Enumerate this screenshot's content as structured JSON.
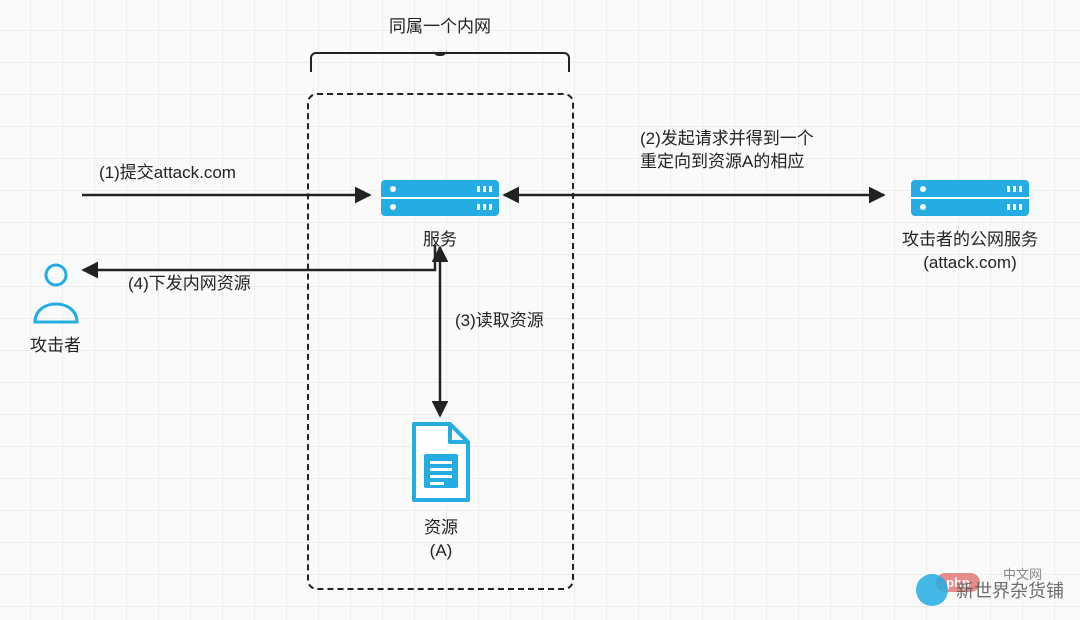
{
  "title": "同属一个内网",
  "nodes": {
    "attacker": {
      "label": "攻击者"
    },
    "service": {
      "label": "服务"
    },
    "resource": {
      "label_line1": "资源",
      "label_line2": "(A)"
    },
    "external_server": {
      "label_line1": "攻击者的公网服务",
      "label_line2": "(attack.com)"
    }
  },
  "edges": {
    "step1": "(1)提交attack.com",
    "step2_line1": "(2)发起请求并得到一个",
    "step2_line2": "重定向到资源A的相应",
    "step3": "(3)读取资源",
    "step4": "(4)下发内网资源"
  },
  "watermark": {
    "text": "新世界杂货铺",
    "suffix": "中文网",
    "pill": "php"
  },
  "colors": {
    "accent": "#25ade3",
    "line": "#222222"
  },
  "chart_data": {
    "type": "diagram",
    "title": "同属一个内网",
    "nodes": [
      {
        "id": "attacker",
        "label": "攻击者",
        "icon": "person"
      },
      {
        "id": "service",
        "label": "服务",
        "icon": "server",
        "group": "intranet"
      },
      {
        "id": "resource",
        "label": "资源 (A)",
        "icon": "document",
        "group": "intranet"
      },
      {
        "id": "external_server",
        "label": "攻击者的公网服务 (attack.com)",
        "icon": "server"
      }
    ],
    "groups": [
      {
        "id": "intranet",
        "label": "同属一个内网",
        "members": [
          "service",
          "resource"
        ]
      }
    ],
    "edges": [
      {
        "from": "attacker",
        "to": "service",
        "label": "(1)提交attack.com",
        "direction": "forward"
      },
      {
        "from": "service",
        "to": "external_server",
        "label": "(2)发起请求并得到一个重定向到资源A的相应",
        "direction": "both"
      },
      {
        "from": "service",
        "to": "resource",
        "label": "(3)读取资源",
        "direction": "both"
      },
      {
        "from": "service",
        "to": "attacker",
        "label": "(4)下发内网资源",
        "direction": "forward"
      }
    ]
  }
}
